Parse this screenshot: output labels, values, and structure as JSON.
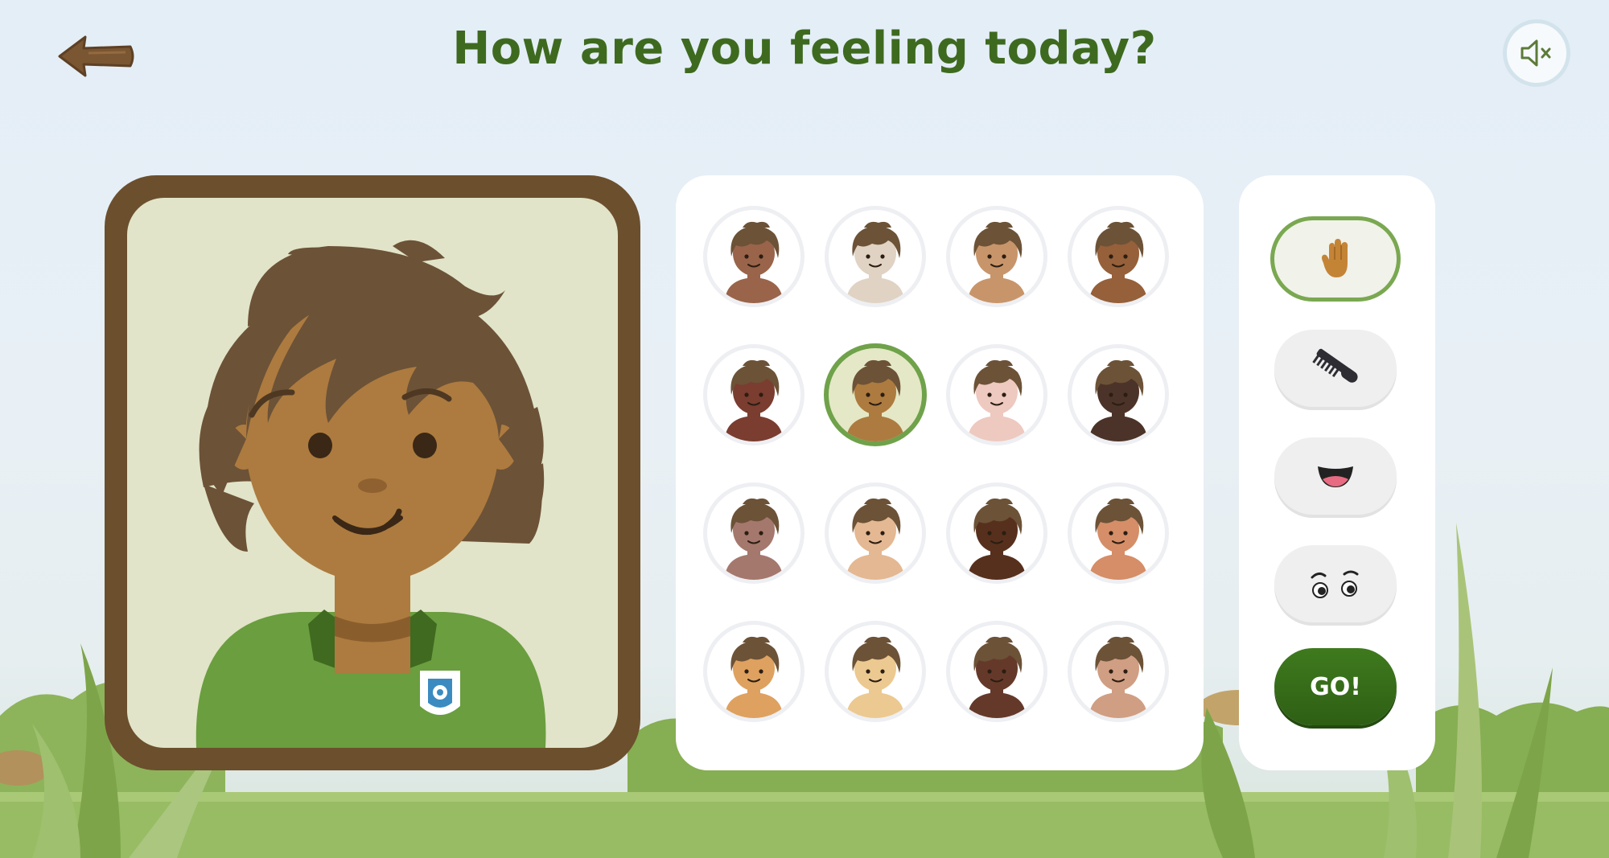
{
  "title": "How are you feeling today?",
  "icons": {
    "back": "back-arrow-icon",
    "mute": "speaker-muted-icon",
    "skin_category": "hand-icon",
    "hair_category": "comb-icon",
    "mouth_category": "mouth-icon",
    "eyes_category": "eyes-icon",
    "logo": "shield-logo-icon"
  },
  "colors": {
    "title": "#3e6a1f",
    "frame": "#6c4f2d",
    "hair": "#6c5237",
    "shirt": "#6a9e3f",
    "selected_ring": "#6fa24a",
    "go_button": "#346b19"
  },
  "avatar_preview": {
    "skin": "#ad7b3f"
  },
  "skin_options": [
    {
      "skin": "#99644a"
    },
    {
      "skin": "#e0d3c4"
    },
    {
      "skin": "#c8956a"
    },
    {
      "skin": "#95603a"
    },
    {
      "skin": "#7a3d30"
    },
    {
      "skin": "#ad7b3f",
      "selected": true
    },
    {
      "skin": "#eec9c0"
    },
    {
      "skin": "#4c3329"
    },
    {
      "skin": "#a5786d"
    },
    {
      "skin": "#e4b892"
    },
    {
      "skin": "#57301d"
    },
    {
      "skin": "#d58e67"
    },
    {
      "skin": "#dea15f"
    },
    {
      "skin": "#ecc990"
    },
    {
      "skin": "#65392a"
    },
    {
      "skin": "#d09e83"
    }
  ],
  "categories": [
    {
      "name": "skin",
      "icon": "hand-icon",
      "active": true
    },
    {
      "name": "hair",
      "icon": "comb-icon"
    },
    {
      "name": "mouth",
      "icon": "mouth-icon"
    },
    {
      "name": "eyes",
      "icon": "eyes-icon"
    }
  ],
  "go_label": "GO!"
}
